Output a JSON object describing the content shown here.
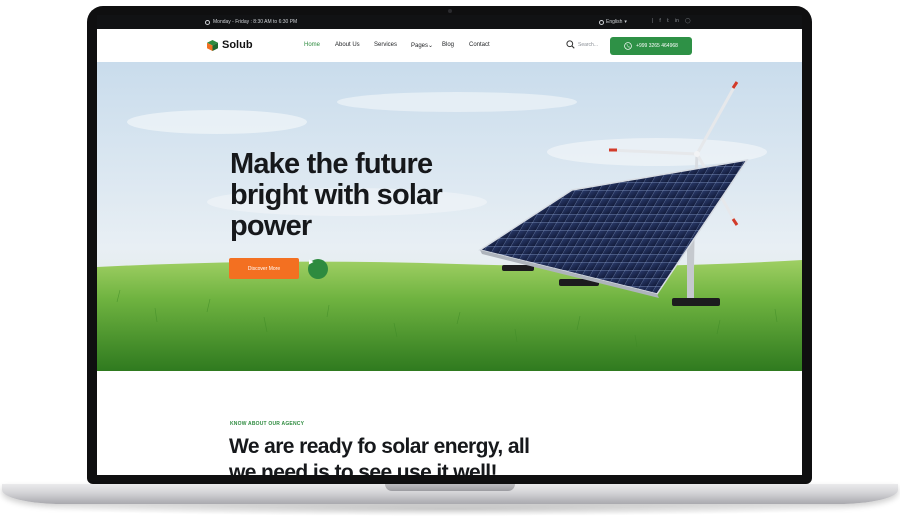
{
  "topbar": {
    "hours": "Monday - Friday : 8:30 AM to 6:30 PM",
    "language": "English",
    "social_icons": [
      "facebook-icon",
      "twitter-icon",
      "linkedin-icon",
      "instagram-icon"
    ]
  },
  "nav": {
    "brand": "Solub",
    "items": [
      {
        "label": "Home",
        "active": true
      },
      {
        "label": "About Us"
      },
      {
        "label": "Services"
      },
      {
        "label": "Pages",
        "has_dropdown": true
      },
      {
        "label": "Blog"
      },
      {
        "label": "Contact"
      }
    ],
    "search_placeholder": "Search...",
    "phone": "+999 3265 464968"
  },
  "hero": {
    "headline_lines": [
      "Make the future",
      "bright with solar",
      "power"
    ],
    "cta_label": "Discover More",
    "play_icon": "play-icon"
  },
  "about": {
    "kicker": "KNOW ABOUT OUR AGENCY",
    "title_lines": [
      "We are ready fo solar energy, all",
      "we need is to see use it well!"
    ]
  },
  "colors": {
    "accent_green": "#2e8b3f",
    "cta_orange": "#f37021",
    "topbar_bg": "#111214",
    "text_dark": "#16181b"
  }
}
